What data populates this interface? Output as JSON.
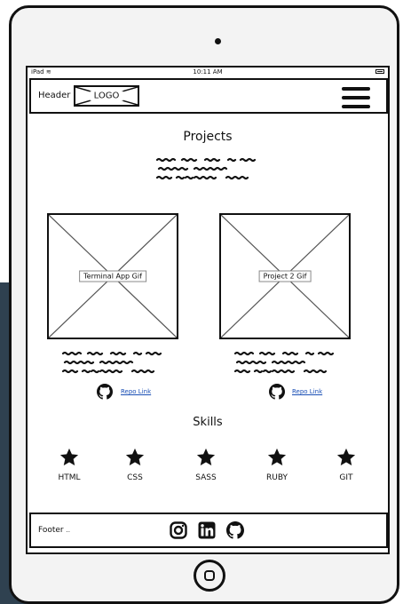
{
  "statusbar": {
    "device": "iPad",
    "time": "10:11 AM"
  },
  "header": {
    "label": "Header",
    "logo": "LOGO",
    "menu_icon": "hamburger-menu-icon"
  },
  "projects": {
    "title": "Projects",
    "items": [
      {
        "gif_label": "Terminal App Gif",
        "repo_link": "Repo Link"
      },
      {
        "gif_label": "Project 2 Gif",
        "repo_link": "Repo Link"
      }
    ]
  },
  "skills": {
    "title": "Skills",
    "items": [
      "HTML",
      "CSS",
      "SASS",
      "RUBY",
      "GIT"
    ]
  },
  "footer": {
    "label": "Footer",
    "ellipsis": "..",
    "icons": [
      "instagram-icon",
      "linkedin-icon",
      "github-icon"
    ]
  },
  "colors": {
    "link": "#1a4fb5",
    "ink": "#111111",
    "device": "#f3f3f3",
    "backdrop": "#2f4150"
  }
}
